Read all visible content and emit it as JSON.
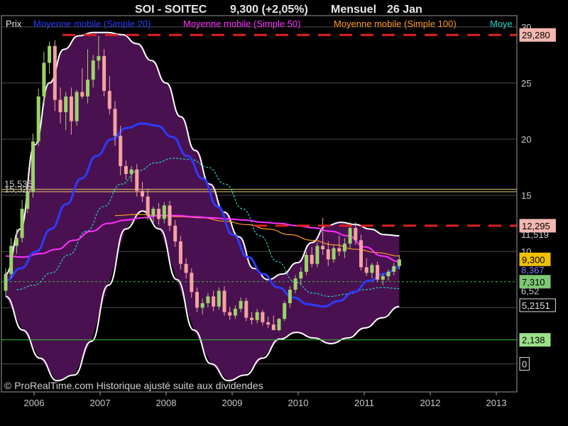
{
  "header": {
    "symbol": "SOI - SOITEC",
    "price_change": "9,300 (+2,05%)",
    "period": "Mensuel",
    "date": "26 Jan"
  },
  "legend": [
    {
      "label": "Prix",
      "color": "#e8e8e8"
    },
    {
      "label": "Moyenne mobile (Simple 20)",
      "color": "#2a3cff"
    },
    {
      "label": "Moyenne mobile (Simple 50)",
      "color": "#ff30ff"
    },
    {
      "label": "Moyenne mobile (Simple 100)",
      "color": "#ff9a20"
    },
    {
      "label": "Moye",
      "color": "#20d0c0"
    }
  ],
  "footer": "© ProRealTime.com Historique ajusté suite aux dividendes",
  "colors": {
    "background": "#000000",
    "band_fill": "#4a1150",
    "up_candle": "#9cd36a",
    "down_candle": "#f2a3a0",
    "grid": "#4a4a4a",
    "resistance": "#e02020"
  },
  "chart_data": {
    "type": "candlestick",
    "x": [
      "2006",
      "2007",
      "2008",
      "2009",
      "2010",
      "2011",
      "2012",
      "2013"
    ],
    "ylim": [
      -2.5,
      31
    ],
    "y_ticks": [
      0,
      5,
      10,
      15,
      20,
      25,
      30
    ],
    "grid": true,
    "candles": [
      {
        "o": 6.5,
        "h": 8.5,
        "l": 6.0,
        "c": 8.0
      },
      {
        "o": 8.0,
        "h": 11.2,
        "l": 7.6,
        "c": 10.5
      },
      {
        "o": 10.5,
        "h": 12.0,
        "l": 9.8,
        "c": 11.2
      },
      {
        "o": 11.2,
        "h": 14.6,
        "l": 10.8,
        "c": 13.8
      },
      {
        "o": 13.8,
        "h": 16.0,
        "l": 13.4,
        "c": 15.3
      },
      {
        "o": 15.3,
        "h": 20.5,
        "l": 14.8,
        "c": 19.8
      },
      {
        "o": 19.8,
        "h": 24.5,
        "l": 19.4,
        "c": 23.8
      },
      {
        "o": 23.8,
        "h": 27.8,
        "l": 23.0,
        "c": 26.8
      },
      {
        "o": 26.8,
        "h": 28.7,
        "l": 25.8,
        "c": 28.3
      },
      {
        "o": 28.3,
        "h": 28.8,
        "l": 22.5,
        "c": 23.5
      },
      {
        "o": 23.5,
        "h": 24.6,
        "l": 21.4,
        "c": 22.4
      },
      {
        "o": 22.4,
        "h": 24.2,
        "l": 20.8,
        "c": 23.8
      },
      {
        "o": 23.8,
        "h": 24.6,
        "l": 20.4,
        "c": 21.6
      },
      {
        "o": 21.6,
        "h": 24.4,
        "l": 21.2,
        "c": 24.2
      },
      {
        "o": 24.2,
        "h": 26.3,
        "l": 23.6,
        "c": 23.8
      },
      {
        "o": 23.8,
        "h": 28.0,
        "l": 23.2,
        "c": 25.3
      },
      {
        "o": 25.3,
        "h": 27.5,
        "l": 24.6,
        "c": 27.0
      },
      {
        "o": 27.0,
        "h": 29.2,
        "l": 26.2,
        "c": 27.4
      },
      {
        "o": 27.4,
        "h": 28.0,
        "l": 23.8,
        "c": 24.3
      },
      {
        "o": 24.3,
        "h": 25.6,
        "l": 22.2,
        "c": 22.7
      },
      {
        "o": 22.7,
        "h": 23.4,
        "l": 19.4,
        "c": 20.3
      },
      {
        "o": 20.3,
        "h": 21.2,
        "l": 16.8,
        "c": 17.6
      },
      {
        "o": 17.6,
        "h": 18.1,
        "l": 16.4,
        "c": 16.9
      },
      {
        "o": 16.9,
        "h": 17.6,
        "l": 16.2,
        "c": 17.3
      },
      {
        "o": 17.3,
        "h": 17.8,
        "l": 14.9,
        "c": 15.4
      },
      {
        "o": 15.4,
        "h": 16.2,
        "l": 14.4,
        "c": 14.9
      },
      {
        "o": 14.9,
        "h": 15.6,
        "l": 12.8,
        "c": 13.2
      },
      {
        "o": 13.2,
        "h": 14.0,
        "l": 12.6,
        "c": 13.8
      },
      {
        "o": 13.8,
        "h": 14.3,
        "l": 12.4,
        "c": 12.9
      },
      {
        "o": 12.9,
        "h": 14.4,
        "l": 12.5,
        "c": 14.1
      },
      {
        "o": 14.1,
        "h": 14.5,
        "l": 11.8,
        "c": 12.3
      },
      {
        "o": 12.3,
        "h": 12.8,
        "l": 10.4,
        "c": 10.9
      },
      {
        "o": 10.9,
        "h": 11.4,
        "l": 8.4,
        "c": 8.9
      },
      {
        "o": 8.9,
        "h": 9.4,
        "l": 7.6,
        "c": 8.1
      },
      {
        "o": 8.1,
        "h": 8.5,
        "l": 5.9,
        "c": 6.4
      },
      {
        "o": 6.4,
        "h": 6.8,
        "l": 4.6,
        "c": 5.0
      },
      {
        "o": 5.0,
        "h": 5.8,
        "l": 4.4,
        "c": 5.4
      },
      {
        "o": 5.4,
        "h": 6.3,
        "l": 5.0,
        "c": 6.0
      },
      {
        "o": 6.0,
        "h": 6.5,
        "l": 4.7,
        "c": 5.1
      },
      {
        "o": 5.1,
        "h": 6.8,
        "l": 4.8,
        "c": 6.5
      },
      {
        "o": 6.5,
        "h": 6.9,
        "l": 4.3,
        "c": 4.6
      },
      {
        "o": 4.6,
        "h": 5.1,
        "l": 3.9,
        "c": 4.3
      },
      {
        "o": 4.3,
        "h": 5.2,
        "l": 4.0,
        "c": 4.9
      },
      {
        "o": 4.9,
        "h": 5.9,
        "l": 4.6,
        "c": 5.6
      },
      {
        "o": 5.6,
        "h": 5.9,
        "l": 3.8,
        "c": 4.1
      },
      {
        "o": 4.1,
        "h": 4.6,
        "l": 3.5,
        "c": 3.9
      },
      {
        "o": 3.9,
        "h": 4.9,
        "l": 3.6,
        "c": 4.6
      },
      {
        "o": 4.6,
        "h": 4.8,
        "l": 3.4,
        "c": 3.7
      },
      {
        "o": 3.7,
        "h": 4.2,
        "l": 3.2,
        "c": 3.5
      },
      {
        "o": 3.5,
        "h": 4.3,
        "l": 3.1,
        "c": 3.0
      },
      {
        "o": 3.0,
        "h": 4.1,
        "l": 2.9,
        "c": 4.0
      },
      {
        "o": 4.0,
        "h": 5.6,
        "l": 3.8,
        "c": 5.4
      },
      {
        "o": 5.4,
        "h": 6.9,
        "l": 5.0,
        "c": 6.6
      },
      {
        "o": 6.6,
        "h": 7.9,
        "l": 6.3,
        "c": 7.6
      },
      {
        "o": 7.6,
        "h": 8.6,
        "l": 7.0,
        "c": 8.2
      },
      {
        "o": 8.2,
        "h": 10.0,
        "l": 7.9,
        "c": 9.7
      },
      {
        "o": 9.7,
        "h": 10.4,
        "l": 8.6,
        "c": 8.9
      },
      {
        "o": 8.9,
        "h": 10.8,
        "l": 8.6,
        "c": 10.5
      },
      {
        "o": 10.5,
        "h": 13.0,
        "l": 9.7,
        "c": 10.2
      },
      {
        "o": 10.2,
        "h": 10.9,
        "l": 8.7,
        "c": 9.3
      },
      {
        "o": 9.3,
        "h": 10.6,
        "l": 9.0,
        "c": 10.3
      },
      {
        "o": 10.3,
        "h": 11.4,
        "l": 9.6,
        "c": 10.0
      },
      {
        "o": 10.0,
        "h": 11.2,
        "l": 9.4,
        "c": 10.7
      },
      {
        "o": 10.7,
        "h": 12.6,
        "l": 10.3,
        "c": 12.1
      },
      {
        "o": 12.1,
        "h": 12.6,
        "l": 10.6,
        "c": 11.0
      },
      {
        "o": 11.0,
        "h": 11.5,
        "l": 8.3,
        "c": 8.6
      },
      {
        "o": 8.6,
        "h": 9.4,
        "l": 7.8,
        "c": 8.1
      },
      {
        "o": 8.1,
        "h": 9.0,
        "l": 7.6,
        "c": 8.8
      },
      {
        "o": 8.8,
        "h": 9.1,
        "l": 7.3,
        "c": 7.5
      },
      {
        "o": 7.5,
        "h": 8.0,
        "l": 7.0,
        "c": 7.8
      },
      {
        "o": 7.8,
        "h": 8.4,
        "l": 7.4,
        "c": 8.2
      },
      {
        "o": 8.2,
        "h": 9.0,
        "l": 7.9,
        "c": 8.7
      },
      {
        "o": 8.7,
        "h": 9.7,
        "l": 8.4,
        "c": 9.3
      }
    ],
    "ma20": [
      7.4,
      8.5,
      10,
      12,
      14.2,
      16.5,
      18.5,
      20,
      21,
      21.4,
      21.2,
      20.2,
      18.5,
      16.5,
      14,
      11.5,
      9.5,
      8,
      6.8,
      5.9,
      5.3,
      5.1,
      5.6,
      6.4,
      7.4,
      8.0,
      8.6
    ],
    "ma50": [
      9.6,
      9.5,
      9.8,
      10.2,
      11,
      11.8,
      12.5,
      12.8,
      13,
      13.2,
      13.2,
      13.1,
      13,
      12.9,
      12.8,
      12.6,
      12.5,
      12.3,
      12.1,
      11.8,
      11.4,
      10.4,
      9.6,
      9.1
    ],
    "ma100": [
      13.2,
      13.3,
      13.2,
      13.1,
      13,
      12.7,
      12.4,
      12.0,
      11.5,
      11.0,
      10.6,
      10.2,
      9.9,
      9.6
    ],
    "ma_extra": [
      6.6,
      7.0,
      8.1,
      9.7,
      11.8,
      14,
      16,
      17.2,
      17.9,
      18.3,
      18.2,
      17.5,
      16.0,
      13.8,
      11.4,
      9.1,
      7.3,
      6.3,
      6.0,
      6.2,
      6.6,
      6.8,
      6.7
    ],
    "band_upper": [
      8,
      12,
      19.5,
      25,
      28,
      29.2,
      29.5,
      29.5,
      29.3,
      28.5,
      27,
      25,
      22,
      19,
      16,
      13.5,
      11.3,
      8.5,
      7.5,
      8,
      9,
      10.8,
      12.3,
      12.6,
      12.4,
      12,
      11.5,
      11.4
    ],
    "band_lower": [
      6,
      3,
      0.5,
      -1.5,
      -1,
      2,
      7,
      12,
      13.6,
      12,
      7.5,
      3,
      0,
      -1.5,
      -1,
      0.5,
      2.2,
      2.8,
      2.3,
      1.8,
      2.3,
      3.2,
      4.1,
      5.1
    ],
    "levels": [
      {
        "label": "29,280",
        "value": 29.28
      },
      {
        "label": "12,295",
        "value": 12.295
      },
      {
        "label": "9,300",
        "value": 9.3
      },
      {
        "label": "7,310",
        "value": 7.31
      },
      {
        "label": "5,2151",
        "value": 5.2151
      },
      {
        "label": "2,138",
        "value": 2.138
      },
      {
        "label": "0",
        "value": 0
      }
    ],
    "overlapped_labels": [
      "11,519",
      "8,367",
      "6,52",
      "15,535",
      "15,327"
    ],
    "horizontal_lines": [
      15.535,
      15.327
    ]
  }
}
